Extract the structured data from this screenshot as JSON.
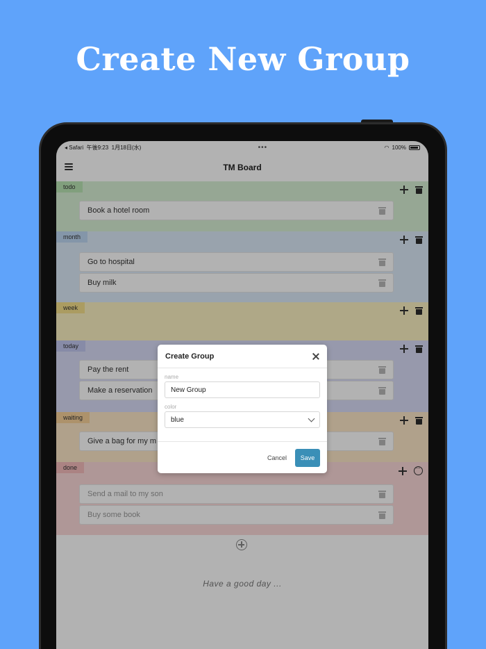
{
  "headline": "Create New Group",
  "status_bar": {
    "carrier": "◂ Safari",
    "time": "午後9:23",
    "date": "1月18日(水)",
    "center": "•••",
    "battery": "100%"
  },
  "app": {
    "title": "TM Board"
  },
  "groups": [
    {
      "name": "todo",
      "color": "#d7f0d4",
      "tag_color": "#b9e4b3",
      "tasks": [
        "Book a hotel room"
      ]
    },
    {
      "name": "month",
      "color": "#dceaf8",
      "tag_color": "#bdd7f2",
      "tasks": [
        "Go to hospital",
        "Buy milk"
      ]
    },
    {
      "name": "week",
      "color": "#fbf1c2",
      "tag_color": "#f5e08c",
      "tasks": []
    },
    {
      "name": "today",
      "color": "#d9dcf6",
      "tag_color": "#c2c7f0",
      "tasks": [
        "Pay the rent",
        "Make a reservation"
      ]
    },
    {
      "name": "waiting",
      "color": "#fde7c8",
      "tag_color": "#f8d29a",
      "tasks": [
        "Give a bag for my m"
      ]
    },
    {
      "name": "done",
      "color": "#fbd9d9",
      "tag_color": "#f5bcbc",
      "tasks": [
        "Send a mail to my son",
        "Buy some book"
      ]
    }
  ],
  "footer": {
    "tagline": "Have a good day ..."
  },
  "modal": {
    "title": "Create Group",
    "name_label": "name",
    "name_value": "New Group",
    "color_label": "color",
    "color_value": "blue",
    "cancel_label": "Cancel",
    "save_label": "Save"
  },
  "colors": {
    "background": "#5fa3fa",
    "save_button": "#3a8fb7"
  }
}
